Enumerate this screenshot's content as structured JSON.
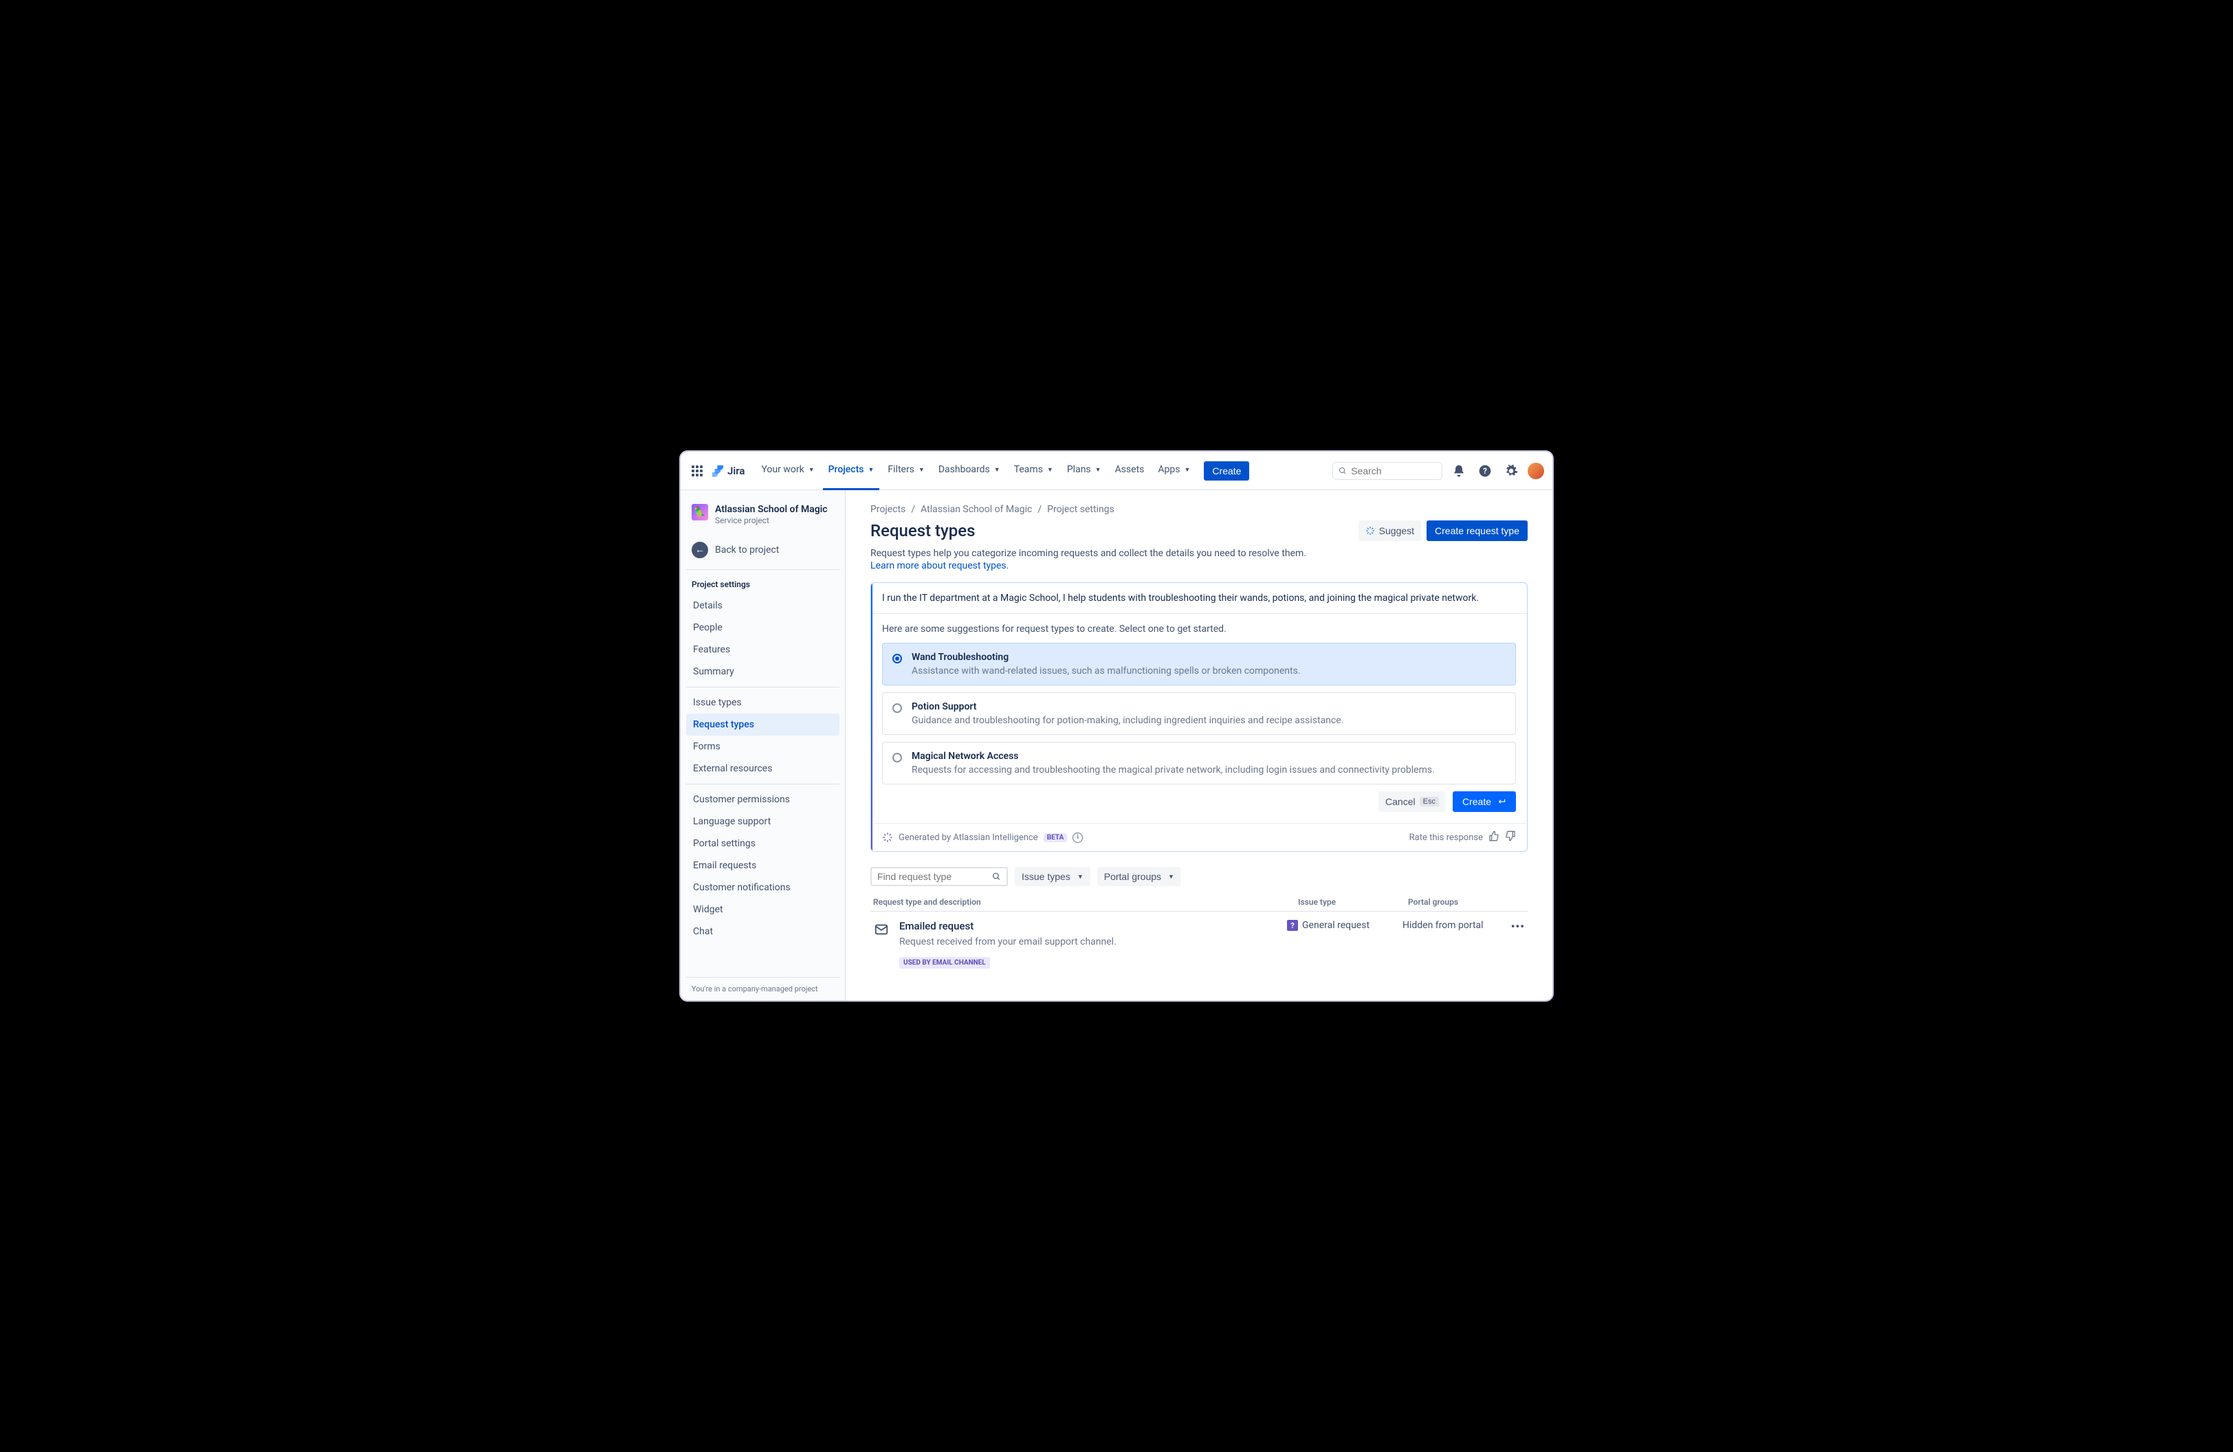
{
  "brand": "Jira",
  "nav": {
    "your_work": "Your work",
    "projects": "Projects",
    "filters": "Filters",
    "dashboards": "Dashboards",
    "teams": "Teams",
    "plans": "Plans",
    "assets": "Assets",
    "apps": "Apps",
    "create": "Create",
    "search_placeholder": "Search"
  },
  "project": {
    "name": "Atlassian School of Magic",
    "subtitle": "Service project",
    "back_label": "Back to project",
    "footer": "You're in a company-managed project"
  },
  "sidebar": {
    "heading": "Project settings",
    "group1": [
      "Details",
      "People",
      "Features",
      "Summary"
    ],
    "group2": [
      "Issue types",
      "Request types",
      "Forms",
      "External resources"
    ],
    "group3": [
      "Customer permissions",
      "Language support",
      "Portal settings",
      "Email requests",
      "Customer notifications",
      "Widget",
      "Chat"
    ]
  },
  "breadcrumbs": [
    "Projects",
    "Atlassian School of Magic",
    "Project settings"
  ],
  "page": {
    "title": "Request types",
    "suggest_btn": "Suggest",
    "create_btn": "Create request type",
    "intro_text": "Request types help you categorize incoming requests and collect the details you need to resolve them.",
    "intro_link": "Learn more about request types."
  },
  "ai": {
    "prompt": "I run the IT department at a Magic School, I help students with troubleshooting their wands, potions, and joining the magical private network.",
    "lead": "Here are some suggestions for request types to create. Select one to get started.",
    "suggestions": [
      {
        "title": "Wand Troubleshooting",
        "desc": "Assistance with wand-related issues, such as malfunctioning spells or broken components.",
        "selected": true
      },
      {
        "title": "Potion Support",
        "desc": "Guidance and troubleshooting for potion-making, including ingredient inquiries and recipe assistance.",
        "selected": false
      },
      {
        "title": "Magical Network Access",
        "desc": "Requests for accessing and troubleshooting the magical private network, including login issues and connectivity problems.",
        "selected": false
      }
    ],
    "cancel": "Cancel",
    "cancel_kbd": "Esc",
    "create": "Create",
    "generated_by": "Generated by Atlassian Intelligence",
    "beta": "BETA",
    "rate_label": "Rate this response"
  },
  "filters": {
    "find_placeholder": "Find request type",
    "issue_types": "Issue types",
    "portal_groups": "Portal groups"
  },
  "table": {
    "head1": "Request type and description",
    "head2": "Issue type",
    "head3": "Portal groups",
    "row": {
      "title": "Emailed request",
      "desc": "Request received from your email support channel.",
      "badge": "USED BY EMAIL CHANNEL",
      "issue_type": "General request",
      "portal": "Hidden from portal"
    }
  }
}
